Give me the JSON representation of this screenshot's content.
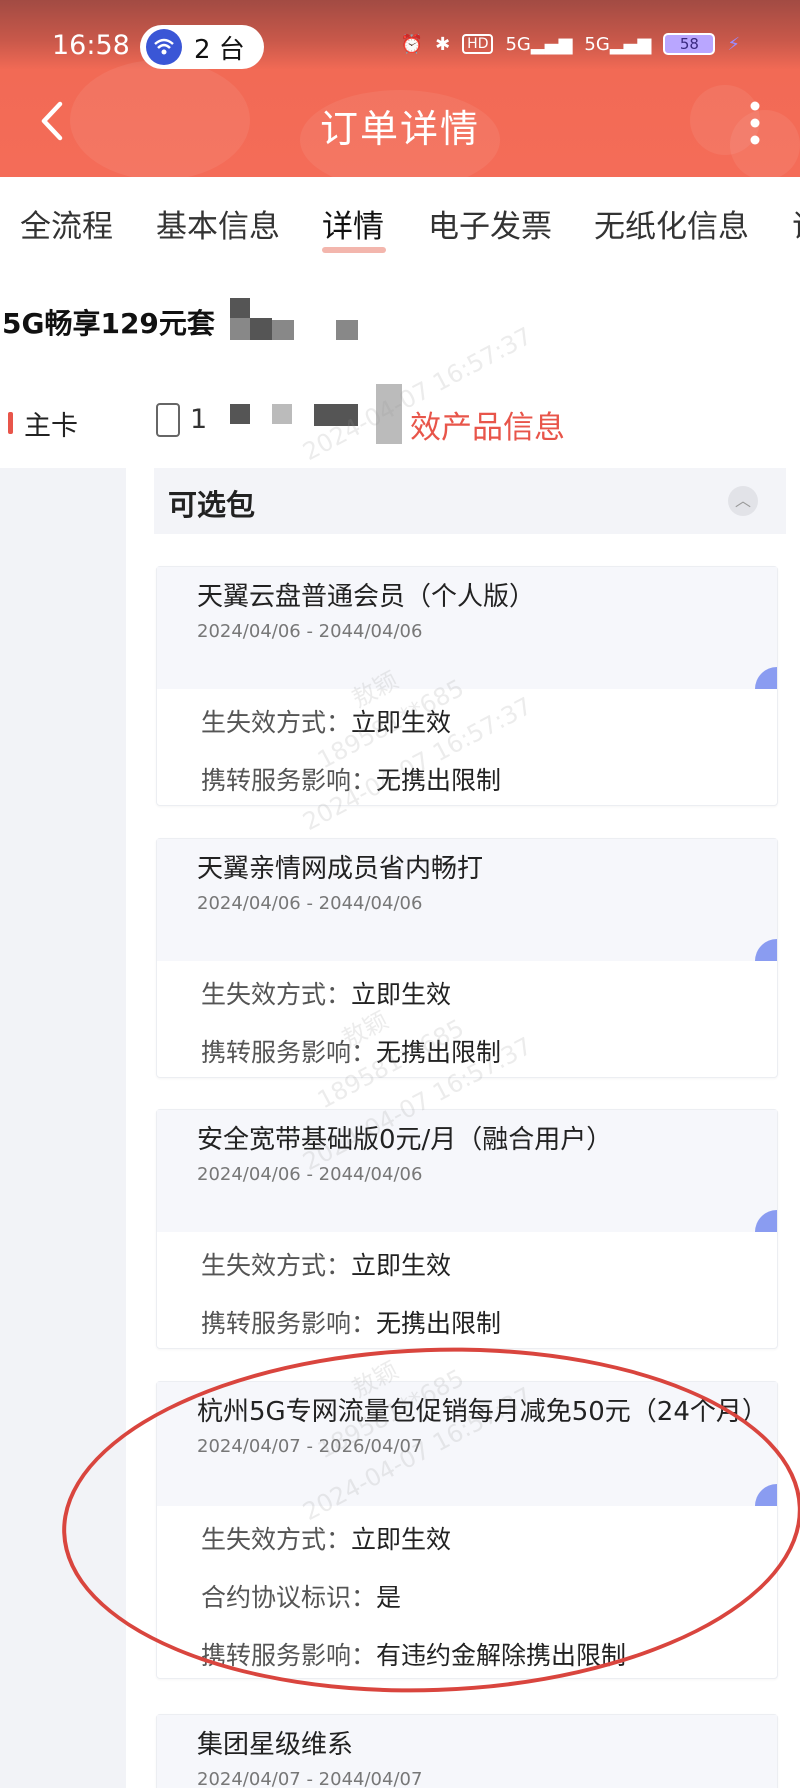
{
  "status_bar": {
    "time": "16:58",
    "hotspot_count": "2 台",
    "battery": "58",
    "network": "5G"
  },
  "header": {
    "title": "订单详情"
  },
  "tabs": [
    {
      "label": "全流程"
    },
    {
      "label": "基本信息"
    },
    {
      "label": "详情"
    },
    {
      "label": "电子发票"
    },
    {
      "label": "无纸化信息"
    },
    {
      "label": "证"
    }
  ],
  "package": {
    "name": "5G畅享129元套"
  },
  "card_info": {
    "label": "主卡",
    "phone": "1",
    "product_link": "效产品信息"
  },
  "section": {
    "title": "可选包"
  },
  "items": [
    {
      "name": "天翼云盘普通会员（个人版）",
      "date": "2024/04/06 - 2044/04/06",
      "effect_label": "生失效方式：",
      "effect_value": "立即生效",
      "port_label": "携转服务影响：",
      "port_value": "无携出限制"
    },
    {
      "name": "天翼亲情网成员省内畅打",
      "date": "2024/04/06 - 2044/04/06",
      "effect_label": "生失效方式：",
      "effect_value": "立即生效",
      "port_label": "携转服务影响：",
      "port_value": "无携出限制"
    },
    {
      "name": "安全宽带基础版0元/月（融合用户）",
      "date": "2024/04/06 - 2044/04/06",
      "effect_label": "生失效方式：",
      "effect_value": "立即生效",
      "port_label": "携转服务影响：",
      "port_value": "无携出限制"
    },
    {
      "name": "杭州5G专网流量包促销每月减免50元（24个月）",
      "date": "2024/04/07 - 2026/04/07",
      "effect_label": "生失效方式：",
      "effect_value": "立即生效",
      "contract_label": "合约协议标识：",
      "contract_value": "是",
      "port_label": "携转服务影响：",
      "port_value": "有违约金解除携出限制"
    },
    {
      "name": "集团星级维系",
      "date": "2024/04/07 - 2044/04/07"
    }
  ],
  "watermark": {
    "name": "敖颖",
    "time": "2024-04-07 16:57:37",
    "number": "189581**685"
  },
  "colors": {
    "header": "#f46c58",
    "accent": "#e8554a",
    "annotation": "#d9453e",
    "corner": "#8a9cf1"
  }
}
